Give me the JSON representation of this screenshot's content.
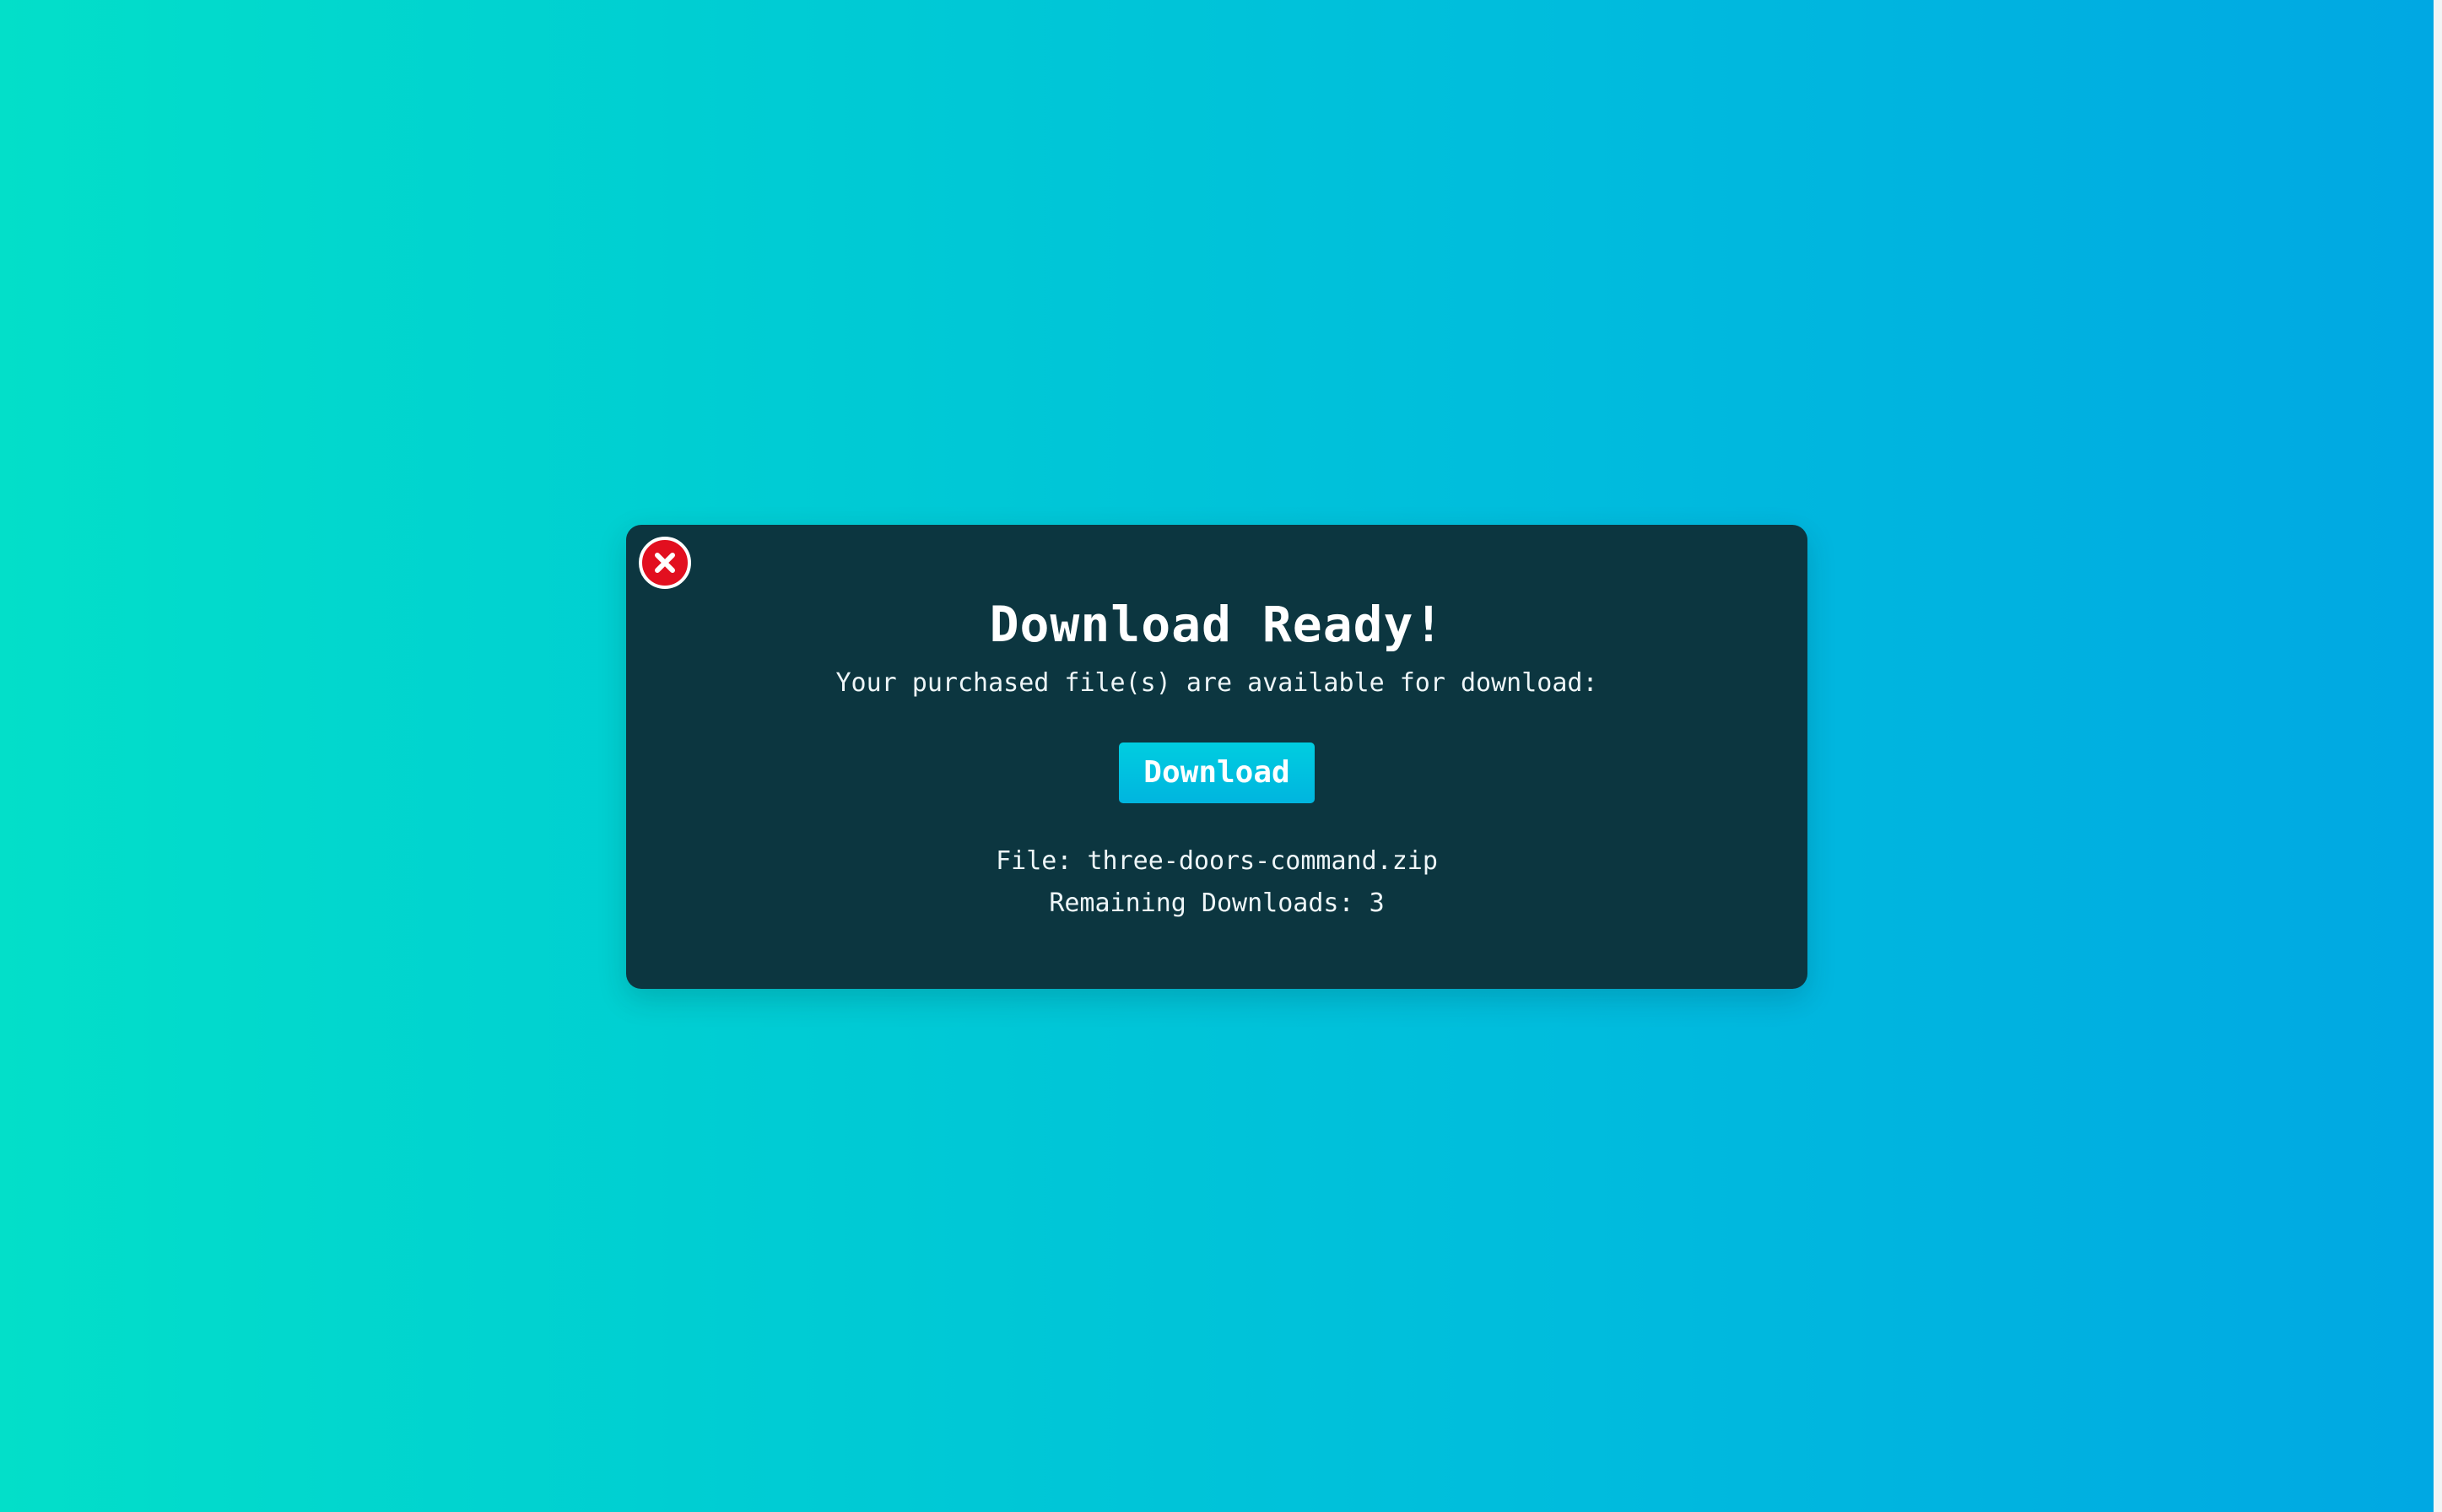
{
  "background": {
    "gradient_start": "#03dfc9",
    "gradient_end": "#00a8e3"
  },
  "modal": {
    "background": "#0c3640",
    "close_icon": "close-x-icon",
    "title": "Download Ready!",
    "subtitle": "Your purchased file(s) are available for download:",
    "download_button_label": "Download",
    "file_label": "File: three-doors-command.zip",
    "remaining_label": "Remaining Downloads: 3"
  }
}
